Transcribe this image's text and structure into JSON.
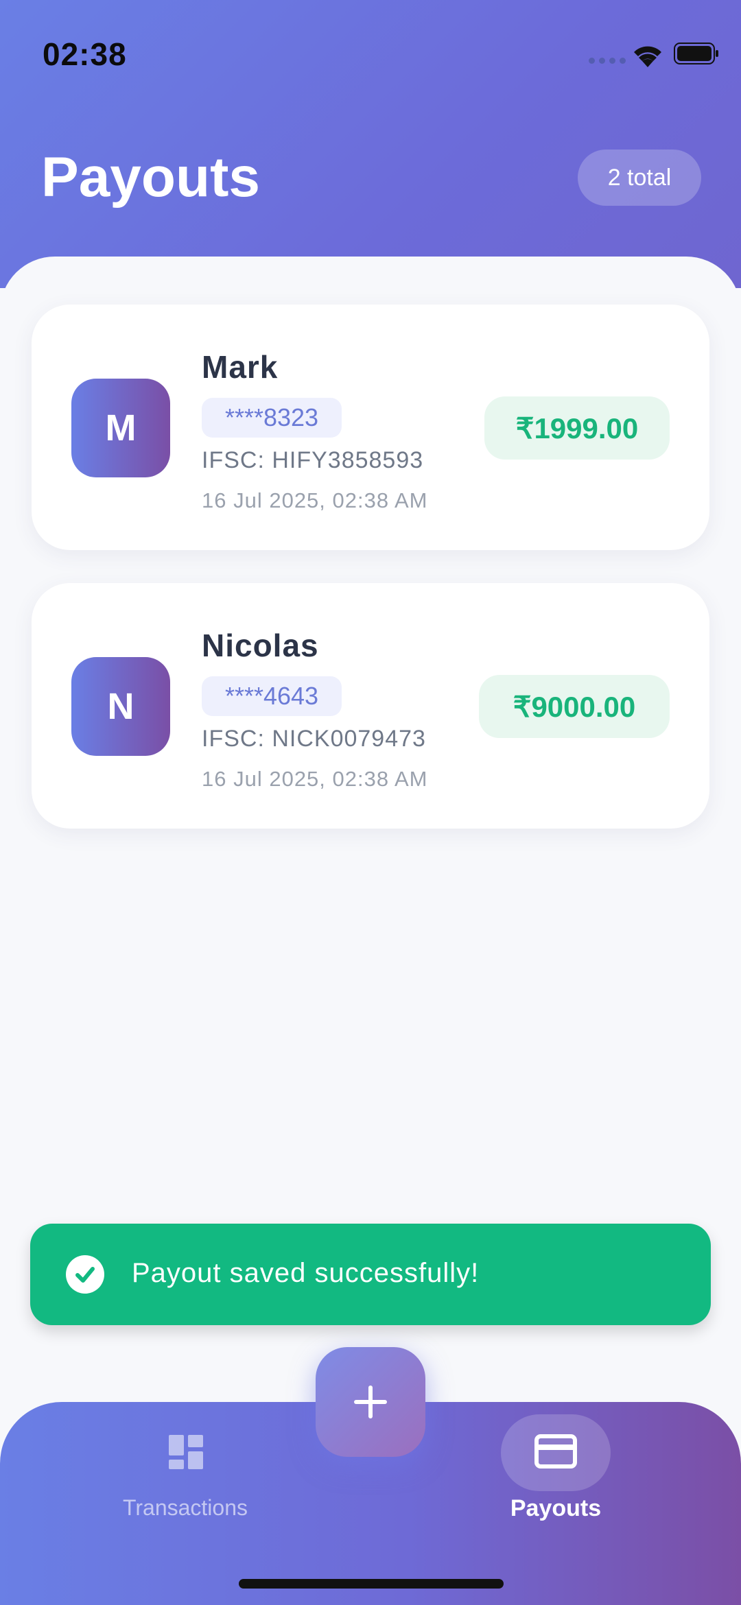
{
  "status_bar": {
    "time": "02:38"
  },
  "header": {
    "title": "Payouts",
    "total_badge": "2 total"
  },
  "payouts": [
    {
      "initial": "M",
      "name": "Mark",
      "account": "****8323",
      "ifsc": "IFSC: HIFY3858593",
      "date": "16 Jul 2025, 02:38 AM",
      "amount": "₹1999.00"
    },
    {
      "initial": "N",
      "name": "Nicolas",
      "account": "****4643",
      "ifsc": "IFSC: NICK0079473",
      "date": "16 Jul 2025, 02:38 AM",
      "amount": "₹9000.00"
    }
  ],
  "toast": {
    "message": "Payout saved successfully!",
    "icon": "check-circle-icon"
  },
  "fab": {
    "icon": "plus-icon"
  },
  "bottom_nav": {
    "items": [
      {
        "label": "Transactions",
        "icon": "dashboard-grid-icon",
        "active": false
      },
      {
        "label": "Payouts",
        "icon": "credit-card-icon",
        "active": true
      }
    ]
  },
  "colors": {
    "accent": "#6a7fe5",
    "success": "#12b981",
    "amount_text": "#19b47b"
  }
}
